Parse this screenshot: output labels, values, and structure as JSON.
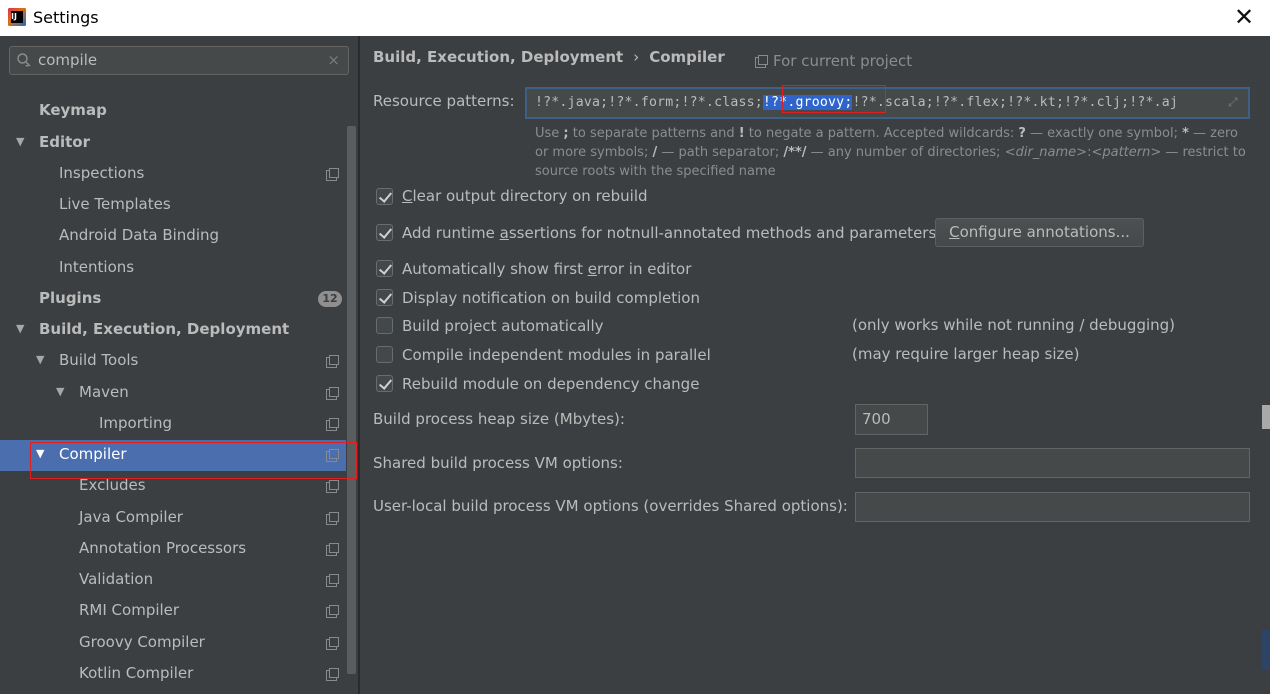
{
  "window": {
    "title": "Settings",
    "close_label": "✕",
    "app_icon_text": "IJ"
  },
  "search": {
    "value": "compile",
    "clear_label": "×"
  },
  "tree": {
    "keymap": "Keymap",
    "editor": "Editor",
    "inspections": "Inspections",
    "live_templates": "Live Templates",
    "android_data_binding": "Android Data Binding",
    "intentions": "Intentions",
    "plugins": "Plugins",
    "plugins_badge": "12",
    "build_execution_deployment": "Build, Execution, Deployment",
    "build_tools": "Build Tools",
    "maven": "Maven",
    "importing": "Importing",
    "compiler": "Compiler",
    "excludes": "Excludes",
    "java_compiler": "Java Compiler",
    "annotation_processors": "Annotation Processors",
    "validation": "Validation",
    "rmi_compiler": "RMI Compiler",
    "groovy_compiler": "Groovy Compiler",
    "kotlin_compiler": "Kotlin Compiler"
  },
  "breadcrumb": {
    "parent": "Build, Execution, Deployment",
    "separator": "›",
    "current": "Compiler",
    "scope": "For current project"
  },
  "resource_patterns": {
    "label": "Resource patterns:",
    "value_before": "!?*.java;!?*.form;!?*.class;",
    "value_selected": "!?*.groovy;",
    "value_after": "!?*.scala;!?*.flex;!?*.kt;!?*.clj;!?*.aj",
    "hint": {
      "a": "Use ",
      "semi": ";",
      "b": " to separate patterns and ",
      "excl": "!",
      "c": " to negate a pattern. Accepted wildcards: ",
      "q": "?",
      "d": " — exactly one symbol; ",
      "star": "*",
      "e": " — zero or more symbols; ",
      "slash": "/",
      "f": " — path separator; ",
      "dstar": "/**/",
      "g": " — any number of directories; ",
      "dirname": "<dir_name>",
      "colon": ":",
      "pattern": "<pattern>",
      "h": " — restrict to source roots with the specified name"
    }
  },
  "options": {
    "clear_output": {
      "pre": "",
      "u": "C",
      "post": "lear output directory on rebuild",
      "checked": true
    },
    "runtime_assertions": {
      "pre": "Add runtime ",
      "u": "a",
      "post": "ssertions for notnull-annotated methods and parameters",
      "checked": true
    },
    "configure_annotations": {
      "pre": "",
      "u": "C",
      "post": "onfigure annotations..."
    },
    "show_first_error": {
      "pre": "Automatically show first ",
      "u": "e",
      "post": "rror in editor",
      "checked": true
    },
    "display_notification": {
      "pre": "Display notification on build completion",
      "u": "",
      "post": "",
      "checked": true
    },
    "build_automatically": {
      "pre": "Build project automatically",
      "u": "",
      "post": "",
      "checked": false,
      "note": "(only works while not running / debugging)"
    },
    "compile_parallel": {
      "pre": "Compile independent modules in parallel",
      "u": "",
      "post": "",
      "checked": false,
      "note": "(may require larger heap size)"
    },
    "rebuild_on_dependency": {
      "pre": "Rebuild module on dependency change",
      "u": "",
      "post": "",
      "checked": true
    }
  },
  "heap": {
    "label": "Build process heap size (Mbytes):",
    "value": "700"
  },
  "shared_vm": {
    "label": "Shared build process VM options:",
    "value": ""
  },
  "user_vm": {
    "label": "User-local build process VM options (overrides Shared options):",
    "value": ""
  },
  "colors": {
    "selection": "#4b6eaf",
    "highlight": "#2f65ca",
    "annotation_box": "#e02020",
    "background": "#3c3f41"
  }
}
